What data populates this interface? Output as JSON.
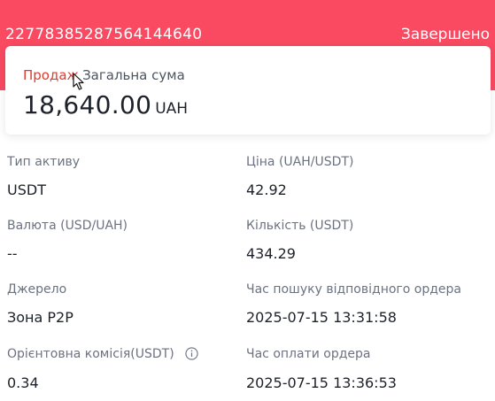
{
  "header": {
    "order_id": "22778385287564144640",
    "status": "Завершено",
    "background_color": "#f94a62"
  },
  "summary": {
    "side_label": "Продаж",
    "total_label": "Загальна сума",
    "amount": "18,640.00",
    "currency": "UAH",
    "side_color": "#e4392f"
  },
  "fields": {
    "asset_type": {
      "label": "Тип активу",
      "value": "USDT"
    },
    "price": {
      "label": "Ціна (UAH/USDT)",
      "value": "42.92"
    },
    "currency_pair": {
      "label": "Валюта (USD/UAH)",
      "value": "--"
    },
    "quantity": {
      "label": "Кількість (USDT)",
      "value": "434.29"
    },
    "source": {
      "label": "Джерело",
      "value": "Зона P2P"
    },
    "match_time": {
      "label": "Час пошуку відповідного ордера",
      "value": "2025-07-15 13:31:58"
    },
    "fee": {
      "label": "Орієнтовна комісія(USDT)",
      "value": "0.34",
      "icon": "info-icon"
    },
    "payment_time": {
      "label": "Час оплати ордера",
      "value": "2025-07-15 13:36:53"
    }
  }
}
